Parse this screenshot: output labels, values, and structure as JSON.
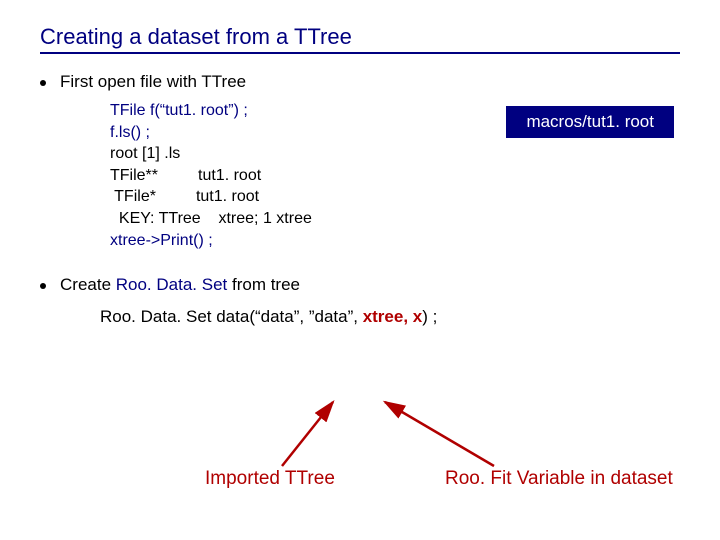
{
  "title": "Creating a dataset from a TTree",
  "bullet1": {
    "text": "First open file with TTree"
  },
  "badge": "macros/tut1. root",
  "code": {
    "l1": "TFile f(“tut1. root”) ;",
    "l2": "f.ls() ;",
    "l3": "root [1] .ls",
    "l4": "TFile**         tut1. root",
    "l5": " TFile*         tut1. root",
    "l6": "  KEY: TTree    xtree; 1 xtree",
    "l7": "xtree->Print() ;"
  },
  "bullet2": {
    "prefix": "Create ",
    "classname": "Roo. Data. Set",
    "suffix": " from tree"
  },
  "code2": {
    "pre": "Roo. Data. Set data(“data”, ”data”, ",
    "arg1": "xtree, ",
    "arg2": "x",
    "post": ") ;"
  },
  "labels": {
    "imported": "Imported TTree",
    "roofit": "Roo. Fit Variable in dataset"
  }
}
